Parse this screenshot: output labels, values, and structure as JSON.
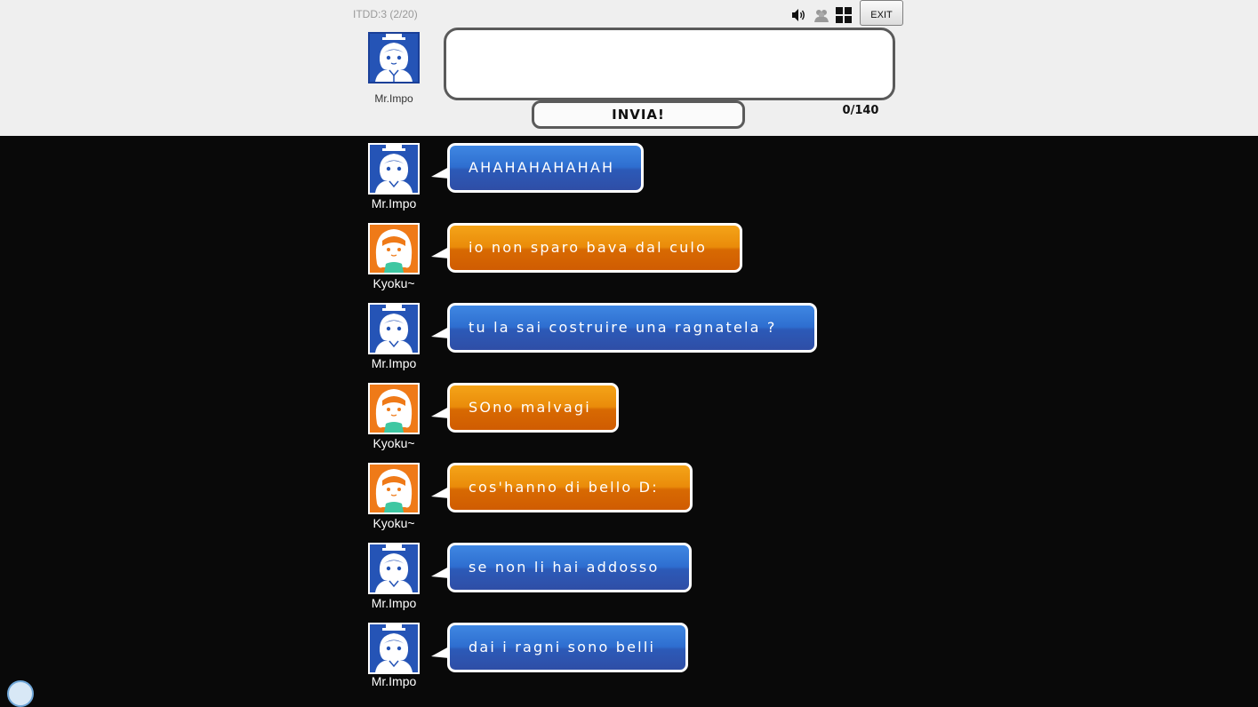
{
  "room": {
    "info": "ITDD:3 (2/20)"
  },
  "self": {
    "name": "Mr.Impo",
    "avatar_color": "#2554b6"
  },
  "composer": {
    "input_value": "",
    "send_label": "INVIA!",
    "counter": "0/140"
  },
  "toolbar": {
    "icons": [
      "sound-icon",
      "members-icon",
      "layout-icon"
    ],
    "exit_label": "EXIT"
  },
  "colors": {
    "header_bg": "#efefef",
    "chat_bg": "#090909",
    "blue_bubble": "#2e6ed0",
    "orange_bubble": "#e0780a"
  },
  "messages": [
    {
      "user": "Mr.Impo",
      "text": "AHAHAHAHAHAH",
      "color": "blue"
    },
    {
      "user": "Kyoku~",
      "text": "io non sparo bava dal culo",
      "color": "orange"
    },
    {
      "user": "Mr.Impo",
      "text": "tu la sai costruire una ragnatela ?",
      "color": "blue"
    },
    {
      "user": "Kyoku~",
      "text": "SOno malvagi",
      "color": "orange"
    },
    {
      "user": "Kyoku~",
      "text": "cos'hanno di bello D:",
      "color": "orange"
    },
    {
      "user": "Mr.Impo",
      "text": "se non li hai addosso",
      "color": "blue"
    },
    {
      "user": "Mr.Impo",
      "text": "dai i ragni sono belli",
      "color": "blue"
    }
  ]
}
